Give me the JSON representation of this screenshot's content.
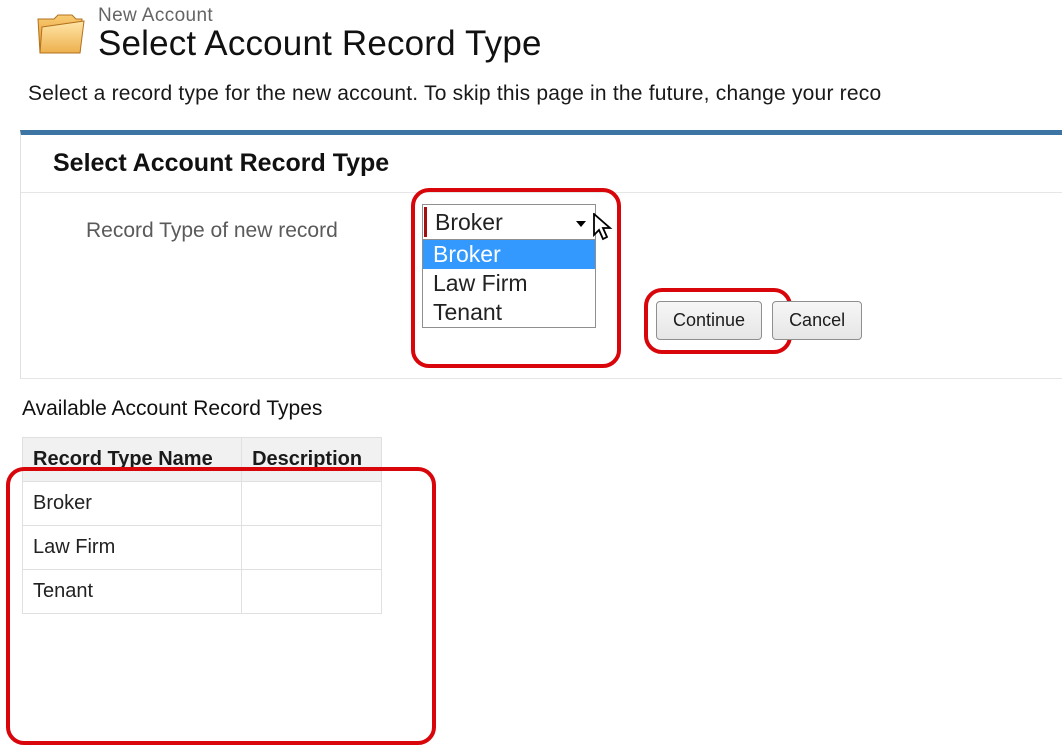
{
  "header": {
    "subtitle": "New Account",
    "title": "Select Account Record Type"
  },
  "intro": "Select a record type for the new account. To skip this page in the future, change your reco",
  "panel": {
    "title": "Select Account Record Type",
    "field_label": "Record Type of new record",
    "select": {
      "current": "Broker",
      "options": [
        "Broker",
        "Law Firm",
        "Tenant"
      ],
      "highlighted_index": 0
    },
    "buttons": {
      "continue": "Continue",
      "cancel": "Cancel"
    }
  },
  "available": {
    "title": "Available Account Record Types",
    "columns": {
      "name": "Record Type Name",
      "desc": "Description"
    },
    "rows": [
      {
        "name": "Broker",
        "desc": ""
      },
      {
        "name": "Law Firm",
        "desc": ""
      },
      {
        "name": "Tenant",
        "desc": ""
      }
    ]
  }
}
